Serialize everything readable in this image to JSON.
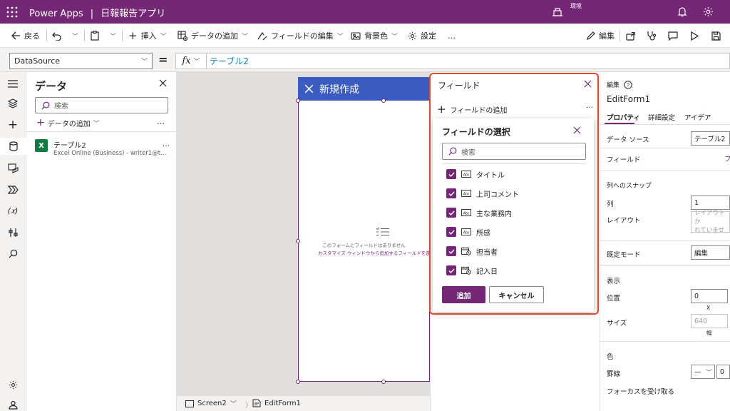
{
  "topbar": {
    "app_name": "Power Apps",
    "separator": "|",
    "app_title": "日報報告アプリ",
    "env_label": "環境"
  },
  "command_bar": {
    "back": "戻る",
    "insert": "挿入",
    "add_data": "データの追加",
    "edit_fields": "フィールドの編集",
    "background": "背景色",
    "settings": "設定",
    "more": "…",
    "edit": "編集"
  },
  "formula_bar": {
    "property": "DataSource",
    "equals": "=",
    "fx": "fx",
    "formula": "テーブル2"
  },
  "data_panel": {
    "title": "データ",
    "search_placeholder": "検索",
    "add_data": "データの追加",
    "more": "…",
    "item": {
      "name": "テーブル2",
      "subtitle": "Excel Online (Business) - writer1@t…",
      "more": "…"
    }
  },
  "canvas": {
    "screen_title": "新規作成",
    "empty_line1": "このフォームにフィールドはありません",
    "empty_line2": "カスタマイズ ウィンドウから追加するフィールドを選択し"
  },
  "bottom_bar": {
    "screen": "Screen2",
    "form": "EditForm1"
  },
  "fields_pane": {
    "title": "フィールド",
    "add_field": "フィールドの追加",
    "more": "…"
  },
  "field_select": {
    "title": "フィールドの選択",
    "search_placeholder": "検索",
    "fields": [
      {
        "label": "タイトル",
        "type": "text",
        "checked": true
      },
      {
        "label": "上司コメント",
        "type": "text",
        "checked": true
      },
      {
        "label": "主な業務内",
        "type": "text",
        "checked": true
      },
      {
        "label": "所感",
        "type": "text",
        "checked": true
      },
      {
        "label": "担当者",
        "type": "date",
        "checked": true
      },
      {
        "label": "記入日",
        "type": "date",
        "checked": true
      }
    ],
    "add_button": "追加",
    "cancel_button": "キャンセル"
  },
  "properties": {
    "header_label": "編集",
    "control_name": "EditForm1",
    "tabs": [
      "プロパティ",
      "詳細設定",
      "アイデア"
    ],
    "datasource_label": "データ ソース",
    "datasource_value": "テーブル2",
    "fields_label": "フィールド",
    "fields_link": "フ",
    "snap_section": "列へのスナップ",
    "columns_label": "列",
    "columns_value": "1",
    "layout_label": "レイアウト",
    "layout_placeholder_1": "レイアウトか",
    "layout_placeholder_2": "れていませ",
    "default_mode_label": "既定モード",
    "default_mode_value": "編集",
    "display_section": "表示",
    "position_label": "位置",
    "position_x": "0",
    "x_caption": "X",
    "size_label": "サイズ",
    "size_width": "640",
    "width_caption": "幅",
    "color_section": "色",
    "border_label": "罫線",
    "border_style": "—",
    "border_width": "0",
    "focus_label": "フォーカスを受け取る"
  },
  "colors": {
    "brand": "#742774",
    "form_header": "#3a5bbf",
    "highlight": "#e0492a",
    "formula_text": "#0f7fb0"
  }
}
